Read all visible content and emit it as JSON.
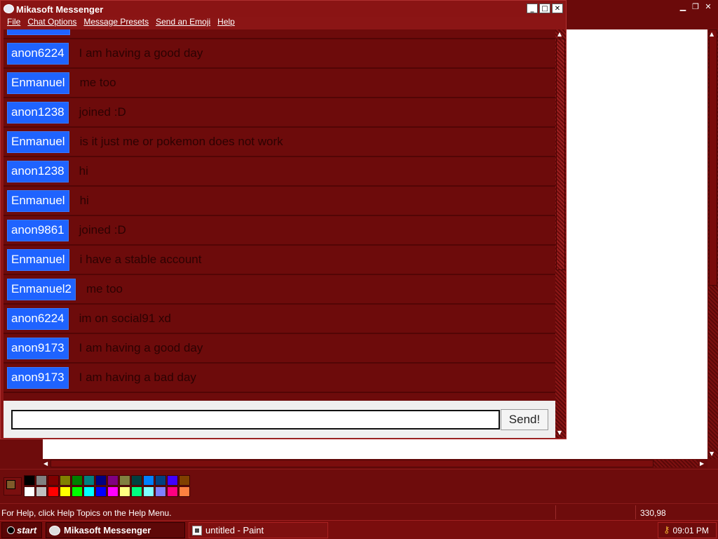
{
  "paint": {
    "status_text": "For Help, click Help Topics on the Help Menu.",
    "coords": "330,98",
    "palette_current": {
      "fg": "#7f5a2a",
      "bg": "#ffffff"
    },
    "palette_colors": [
      "#000000",
      "#808080",
      "#800000",
      "#808000",
      "#008000",
      "#008080",
      "#000080",
      "#800080",
      "#808040",
      "#004040",
      "#0080ff",
      "#004080",
      "#4000ff",
      "#804000",
      "#ffffff",
      "#c0c0c0",
      "#ff0000",
      "#ffff00",
      "#00ff00",
      "#00ffff",
      "#0000ff",
      "#ff00ff",
      "#ffff80",
      "#00ff80",
      "#80ffff",
      "#8080ff",
      "#ff0080",
      "#ff8040"
    ]
  },
  "messenger": {
    "title": "Mikasoft Messenger",
    "menu": [
      "File",
      "Chat Options",
      "Message Presets",
      "Send an Emoji",
      "Help"
    ],
    "messages": [
      {
        "user": "anon6224",
        "text": "I am having a good day"
      },
      {
        "user": "Enmanuel",
        "text": "me too"
      },
      {
        "user": "anon1238",
        "text": "joined :D"
      },
      {
        "user": "Enmanuel",
        "text": "is it just me or pokemon does not work"
      },
      {
        "user": "anon1238",
        "text": "hi"
      },
      {
        "user": "Enmanuel",
        "text": "hi"
      },
      {
        "user": "anon9861",
        "text": "joined :D"
      },
      {
        "user": "Enmanuel",
        "text": "i have a stable account"
      },
      {
        "user": "Enmanuel2",
        "text": "me too"
      },
      {
        "user": "anon6224",
        "text": "im on social91 xd"
      },
      {
        "user": "anon9173",
        "text": "I am having a good day"
      },
      {
        "user": "anon9173",
        "text": "I am having a bad day"
      }
    ],
    "input_value": "",
    "send_label": "Send!"
  },
  "taskbar": {
    "start_label": "start",
    "tasks": [
      "Mikasoft Messenger",
      "untitled - Paint"
    ],
    "clock": "09:01 PM"
  },
  "colors": {
    "desktop": "#6e0c0c",
    "username_badge": "#1f63ff"
  }
}
